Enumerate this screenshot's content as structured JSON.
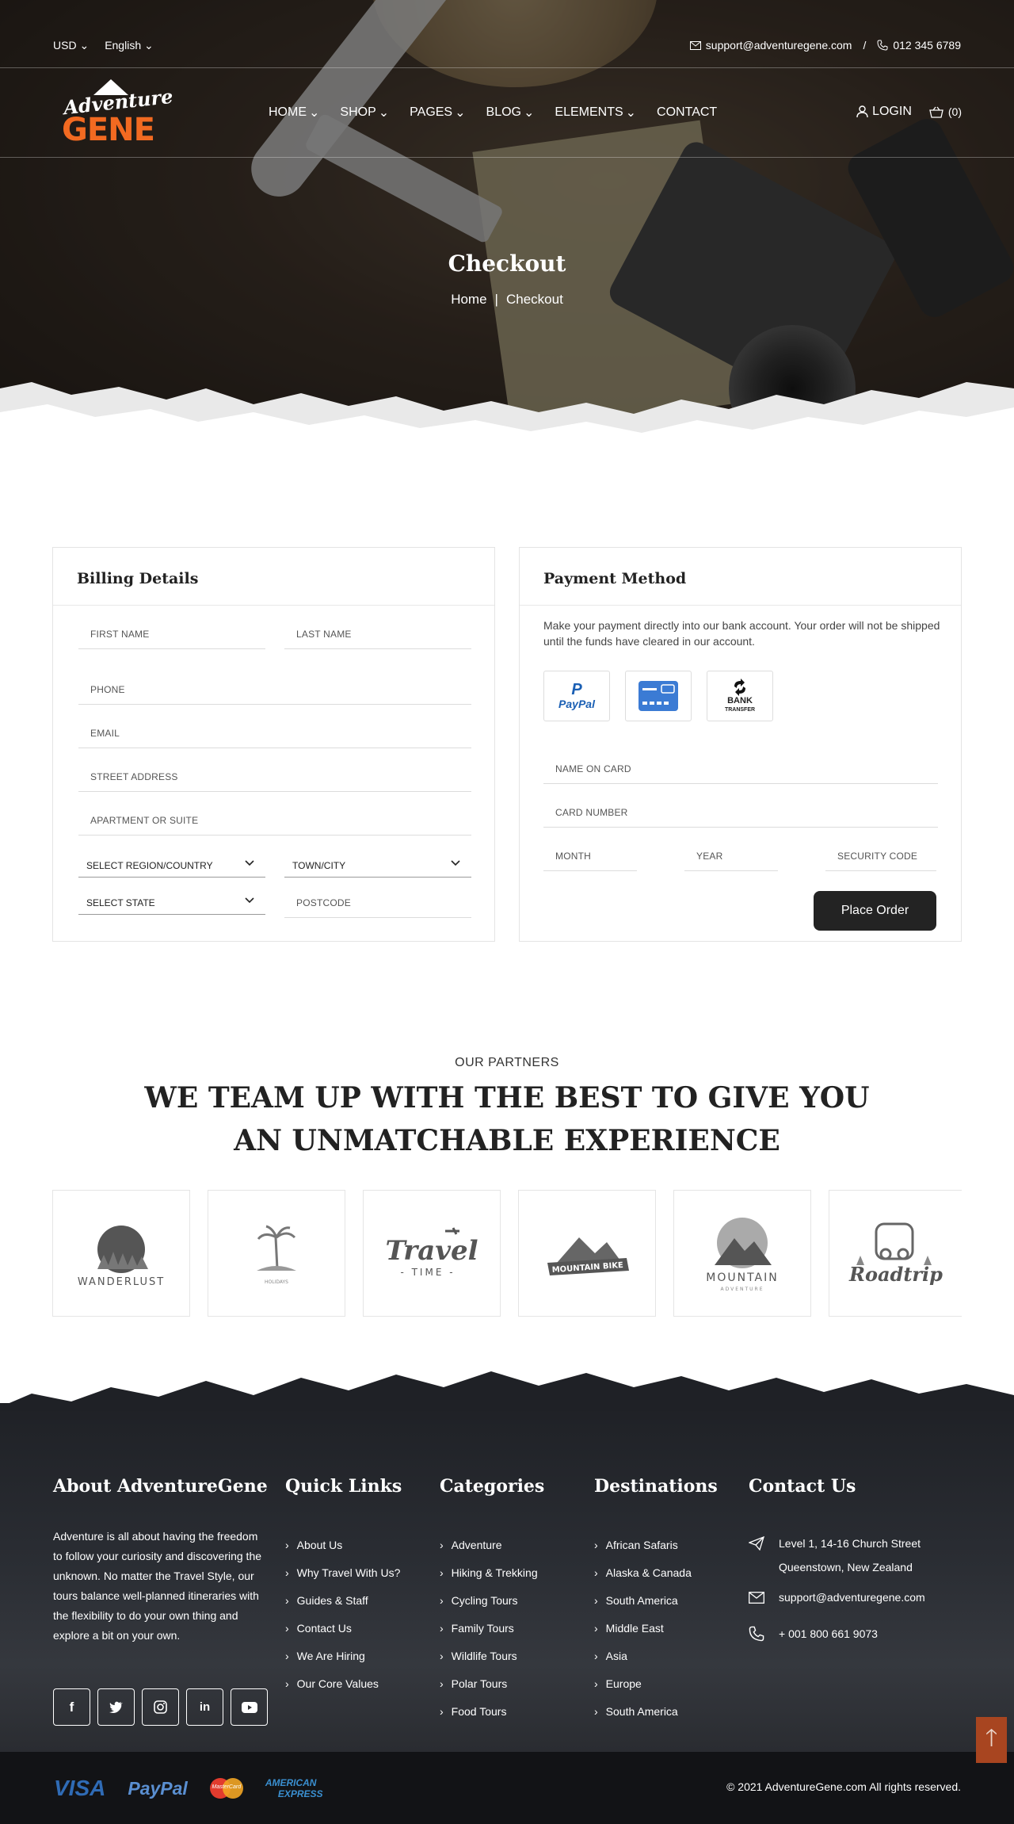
{
  "topbar": {
    "currency": "USD",
    "language": "English",
    "email": "support@adventuregene.com",
    "separator": "/",
    "phone": "012 345 6789"
  },
  "logo": {
    "line1": "Adventure",
    "line2": "GENE"
  },
  "nav": {
    "items": [
      "HOME",
      "SHOP",
      "PAGES",
      "BLOG",
      "ELEMENTS",
      "CONTACT"
    ],
    "login": "LOGIN",
    "cart": "(0)"
  },
  "hero": {
    "title": "Checkout",
    "crumb_home": "Home",
    "crumb_sep": "|",
    "crumb_current": "Checkout"
  },
  "billing": {
    "title": "Billing Details",
    "first_name": "FIRST NAME",
    "last_name": "LAST NAME",
    "phone": "PHONE",
    "email": "EMAIL",
    "street": "STREET ADDRESS",
    "apartment": "APARTMENT OR SUITE",
    "region": "SELECT REGION/COUNTRY",
    "town": "TOWN/CITY",
    "state": "SELECT STATE",
    "postcode": "POSTCODE"
  },
  "payment": {
    "title": "Payment Method",
    "text": "Make your payment directly into our bank account. Your order will not be shipped until the funds have cleared in our account.",
    "paypal": "PayPal",
    "bank_line1": "BANK",
    "bank_line2": "TRANSFER",
    "name_on_card": "NAME ON CARD",
    "card_number": "CARD NUMBER",
    "month": "MONTH",
    "year": "YEAR",
    "security": "SECURITY CODE",
    "place_order": "Place Order"
  },
  "partners": {
    "kicker": "OUR PARTNERS",
    "title": "WE TEAM UP WITH THE BEST TO GIVE YOU AN UNMATCHABLE EXPERIENCE",
    "logos": [
      "WANDERLUST",
      "HOLIDAYS",
      "Travel",
      "- TIME -",
      "MOUNTAIN BIKE",
      "MOUNTAIN",
      "ADVENTURE",
      "Roadtrip"
    ]
  },
  "footer": {
    "about_title": "About AdventureGene",
    "about_text": "Adventure is all about having the freedom to follow your curiosity and discovering the unknown. No matter the Travel Style, our tours balance well-planned itineraries with the flexibility to do your own thing and explore a bit on your own.",
    "quick_title": "Quick Links",
    "quick": [
      "About Us",
      "Why Travel With Us?",
      "Guides & Staff",
      "Contact Us",
      "We Are Hiring",
      "Our Core Values"
    ],
    "cat_title": "Categories",
    "categories": [
      "Adventure",
      "Hiking & Trekking",
      "Cycling Tours",
      "Family Tours",
      "Wildlife Tours",
      "Polar Tours",
      "Food Tours"
    ],
    "dest_title": "Destinations",
    "destinations": [
      "African Safaris",
      "Alaska & Canada",
      "South America",
      "Middle East",
      "Asia",
      "Europe",
      "South America"
    ],
    "contact_title": "Contact Us",
    "address1": "Level 1, 14-16 Church Street",
    "address2": "Queenstown, New Zealand",
    "email": "support@adventuregene.com",
    "phone": "+ 001 800 661 9073",
    "social": [
      "facebook-icon",
      "twitter-icon",
      "instagram-icon",
      "linkedin-icon",
      "youtube-icon"
    ]
  },
  "bottom": {
    "visa": "VISA",
    "paypal": "PayPal",
    "mastercard": "MasterCard",
    "amex1": "AMERICAN",
    "amex2": "EXPRESS",
    "copyright": "© 2021 AdventureGene.com All rights reserved."
  },
  "colors": {
    "accent": "#f26a21",
    "dark": "#232323",
    "footer_bg": "#25272c",
    "scrolltop": "#a84520"
  }
}
